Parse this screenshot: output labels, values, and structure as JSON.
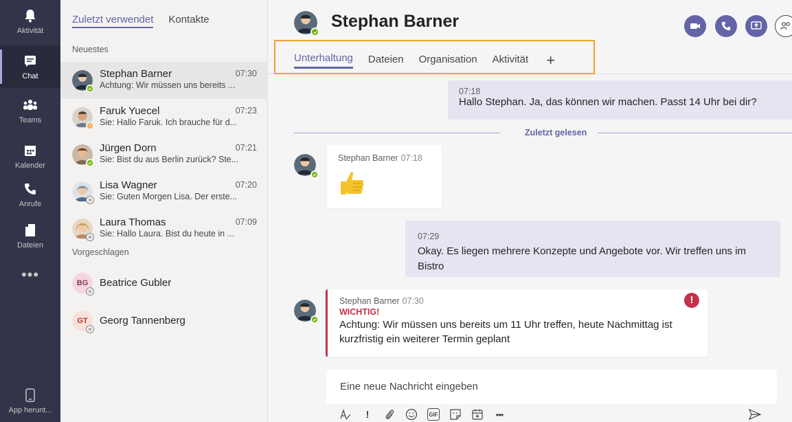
{
  "rail": {
    "items": [
      {
        "label": "Aktivität",
        "icon": "bell-icon"
      },
      {
        "label": "Chat",
        "icon": "chat-icon"
      },
      {
        "label": "Teams",
        "icon": "teams-icon"
      },
      {
        "label": "Kalender",
        "icon": "calendar-icon"
      },
      {
        "label": "Anrufe",
        "icon": "phone-icon"
      },
      {
        "label": "Dateien",
        "icon": "files-icon"
      }
    ],
    "more": "•••",
    "download_label": "App herunt..."
  },
  "list": {
    "tabs": [
      "Zuletzt verwendet",
      "Kontakte"
    ],
    "recent_label": "Neuestes",
    "suggested_label": "Vorgeschlagen",
    "chats": [
      {
        "name": "Stephan Barner",
        "time": "07:30",
        "preview": "Achtung: Wir müssen uns bereits ...",
        "status": "available"
      },
      {
        "name": "Faruk Yuecel",
        "time": "07:23",
        "preview": "Sie: Hallo Faruk. Ich brauche für d...",
        "status": "away"
      },
      {
        "name": "Jürgen Dorn",
        "time": "07:21",
        "preview": "Sie: Bist du aus Berlin zurück? Ste...",
        "status": "available"
      },
      {
        "name": "Lisa Wagner",
        "time": "07:20",
        "preview": "Sie: Guten Morgen Lisa. Der erste...",
        "status": "offline"
      },
      {
        "name": "Laura Thomas",
        "time": "07:09",
        "preview": "Sie: Hallo Laura. Bist du heute in ...",
        "status": "offline"
      }
    ],
    "suggested": [
      {
        "initials": "BG",
        "name": "Beatrice Gubler"
      },
      {
        "initials": "GT",
        "name": "Georg Tannenberg"
      }
    ]
  },
  "header": {
    "name": "Stephan Barner",
    "tabs": [
      "Unterhaltung",
      "Dateien",
      "Organisation",
      "Aktivität"
    ],
    "add_tab": "+"
  },
  "messages": {
    "m1": {
      "time": "07:18",
      "text": "Hallo Stephan. Ja, das können wir machen. Passt 14 Uhr bei dir?"
    },
    "divider": "Zuletzt gelesen",
    "m2": {
      "sender": "Stephan Barner",
      "time": "07:18",
      "emoji": "👍"
    },
    "m3": {
      "time": "07:29",
      "text": "Okay. Es liegen mehrere Konzepte und Angebote vor. Wir treffen uns im Bistro"
    },
    "m4": {
      "sender": "Stephan Barner",
      "time": "07:30",
      "flag": "WICHTIG!",
      "text": "Achtung: Wir müssen uns bereits um 11 Uhr treffen, heute Nachmittag ist kurzfristig ein weiterer Termin geplant",
      "badge": "!"
    }
  },
  "compose": {
    "placeholder": "Eine neue Nachricht eingeben",
    "tools": [
      "format-icon",
      "important-icon",
      "attach-icon",
      "emoji-icon",
      "gif-icon",
      "sticker-icon",
      "meeting-icon",
      "more-icon"
    ],
    "gif_label": "GIF",
    "important_glyph": "!",
    "more_glyph": "•••"
  },
  "colors": {
    "accent": "#6264a7",
    "rail": "#33344a",
    "available": "#6bb700",
    "away": "#ffaa44",
    "important": "#c4314b",
    "highlight_box": "#f0a030"
  }
}
